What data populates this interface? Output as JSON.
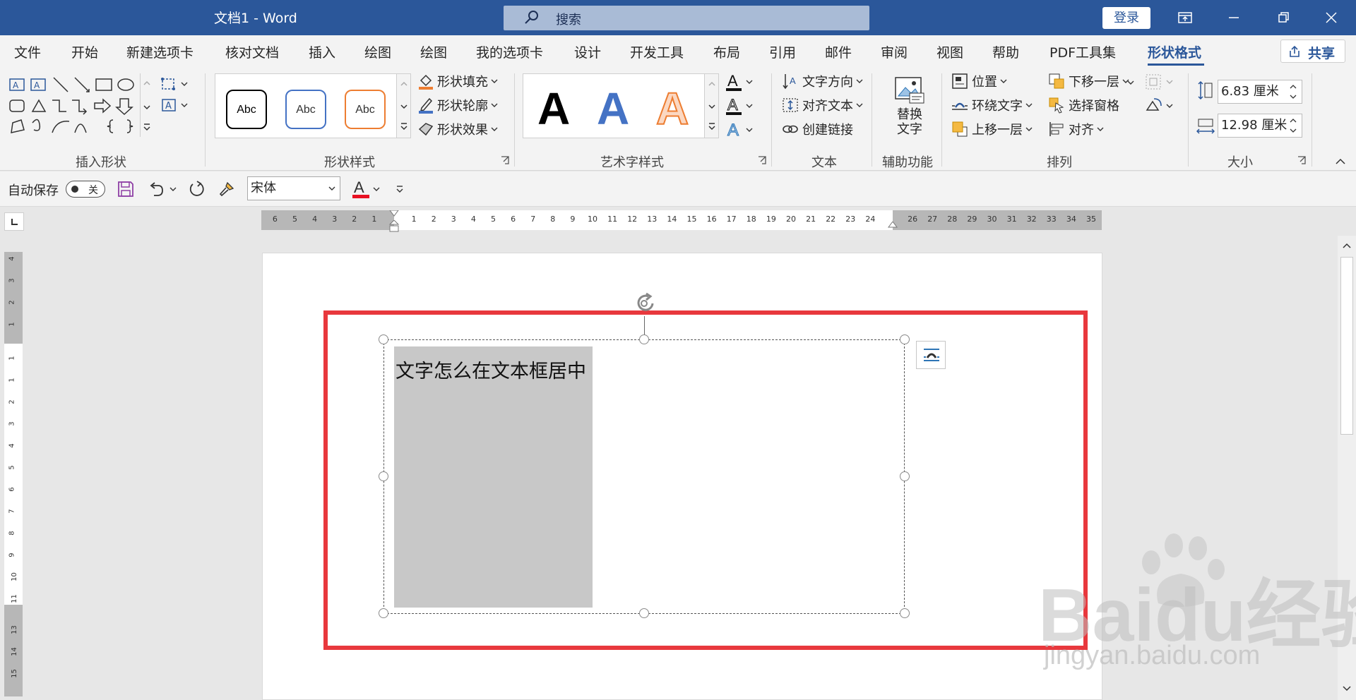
{
  "window": {
    "title": "文档1  -  Word",
    "search_placeholder": "搜索",
    "login_label": "登录"
  },
  "tabs": [
    {
      "label": "文件"
    },
    {
      "label": "开始"
    },
    {
      "label": "新建选项卡"
    },
    {
      "label": "核对文档"
    },
    {
      "label": "插入"
    },
    {
      "label": "绘图"
    },
    {
      "label": "绘图"
    },
    {
      "label": "我的选项卡"
    },
    {
      "label": "设计"
    },
    {
      "label": "开发工具"
    },
    {
      "label": "布局"
    },
    {
      "label": "引用"
    },
    {
      "label": "邮件"
    },
    {
      "label": "审阅"
    },
    {
      "label": "视图"
    },
    {
      "label": "帮助"
    },
    {
      "label": "PDF工具集"
    },
    {
      "label": "形状格式"
    }
  ],
  "active_tab": "形状格式",
  "share_label": "共享",
  "ribbon": {
    "groups": {
      "insert_shapes": "插入形状",
      "shape_styles": "形状样式",
      "wordart_styles": "艺术字样式",
      "text": "文本",
      "accessibility": "辅助功能",
      "arrange": "排列",
      "size": "大小"
    },
    "style_samples": [
      "Abc",
      "Abc",
      "Abc"
    ],
    "style_sample_colors": [
      "#000000",
      "#4472c4",
      "#ed7d31"
    ],
    "shape_fill": "形状填充",
    "shape_outline": "形状轮廓",
    "shape_effects": "形状效果",
    "wordart_sample": "A",
    "text_direction": "文字方向",
    "align_text": "对齐文本",
    "create_link": "创建链接",
    "alt_text": "替换\n文字",
    "position": "位置",
    "wrap_text": "环绕文字",
    "bring_forward": "上移一层",
    "send_backward": "下移一层",
    "selection_pane": "选择窗格",
    "align": "对齐",
    "height": "6.83 厘米",
    "width": "12.98 厘米"
  },
  "qat": {
    "autosave_label": "自动保存",
    "autosave_state": "关",
    "font_name": "宋体"
  },
  "ruler": {
    "h_left": [
      "6",
      "5",
      "4",
      "3",
      "2",
      "1"
    ],
    "h_main": [
      "1",
      "2",
      "3",
      "4",
      "5",
      "6",
      "7",
      "8",
      "9",
      "10",
      "11",
      "12",
      "13",
      "14",
      "15",
      "16",
      "17",
      "18",
      "19",
      "20",
      "21",
      "22",
      "23",
      "24"
    ],
    "h_right": [
      "26",
      "27",
      "28",
      "29",
      "30",
      "31",
      "32",
      "33",
      "34",
      "35"
    ],
    "v_top": [
      "4",
      "3",
      "2",
      "1"
    ],
    "v_main": [
      "1",
      "1",
      "2",
      "3",
      "4",
      "5",
      "6",
      "7",
      "8",
      "9",
      "10",
      "11"
    ],
    "v_bottom": [
      "13",
      "14",
      "15"
    ]
  },
  "document": {
    "textbox_text": "文字怎么在文本框居中"
  },
  "watermark": {
    "brand": "Baidu经验",
    "url": "jingyan.baidu.com"
  },
  "colors": {
    "title_bar": "#2b579a",
    "highlight_frame": "#e8383d",
    "gray_fill": "#c8c8c8",
    "font_color_bar": "#e81123"
  }
}
